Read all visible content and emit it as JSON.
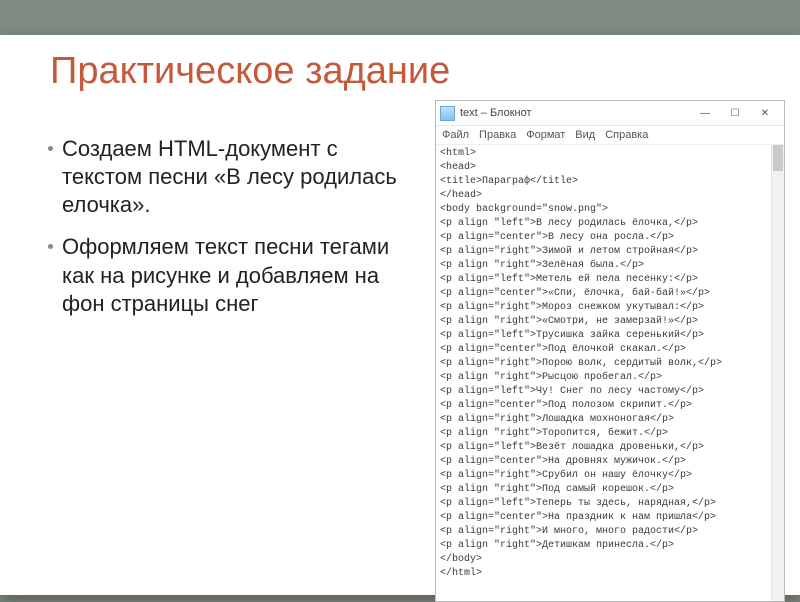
{
  "slide": {
    "title": "Практическое задание",
    "bullets": [
      "Создаем HTML-документ с текстом песни «В лесу родилась елочка».",
      "Оформляем текст песни тегами как на рисунке и добавляем на фон страницы снег"
    ]
  },
  "notepad": {
    "title": "text – Блокнот",
    "window_controls": {
      "min": "—",
      "max": "☐",
      "close": "✕"
    },
    "menu": [
      "Файл",
      "Правка",
      "Формат",
      "Вид",
      "Справка"
    ],
    "code_lines": [
      "<html>",
      "<head>",
      "<title>Параграф</title>",
      "</head>",
      "<body background=\"snow.png\">",
      "<p align \"left\">В лесу родилась ёлочка,</p>",
      "<p align=\"center\">В лесу она росла.</p>",
      "<p align=\"right\">Зимой и летом стройная</p>",
      "<p align \"right\">Зелёная была.</p>",
      "<p align=\"left\">Метель ей пела песенку:</p>",
      "<p align=\"center\">«Спи, ёлочка, бай-бай!»</p>",
      "<p align=\"right\">Мороз снежком укутывал:</p>",
      "<p align \"right\">«Смотри, не замерзай!»</p>",
      "<p align=\"left\">Трусишка зайка серенький</p>",
      "<p align=\"center\">Под ёлочкой скакал.</p>",
      "<p align=\"right\">Порою волк, сердитый волк,</p>",
      "<p align \"right\">Рысцою пробегал.</p>",
      "<p align=\"left\">Чу! Снег по лесу частому</p>",
      "<p align=\"center\">Под полозом скрипит.</p>",
      "<p align=\"right\">Лошадка мохноногая</p>",
      "<p align \"right\">Торопится, бежит.</p>",
      "<p align=\"left\">Везёт лошадка дровеньки,</p>",
      "<p align=\"center\">На дровнях мужичок.</p>",
      "<p align=\"right\">Срубил он нашу ёлочку</p>",
      "<p align \"right\">Под самый корешок.</p>",
      "<p align=\"left\">Теперь ты здесь, нарядная,</p>",
      "<p align=\"center\">На праздник к нам пришла</p>",
      "<p align=\"right\">И много, много радости</p>",
      "<p align \"right\">Детишкам принесла.</p>",
      "</body>",
      "</html>"
    ]
  }
}
